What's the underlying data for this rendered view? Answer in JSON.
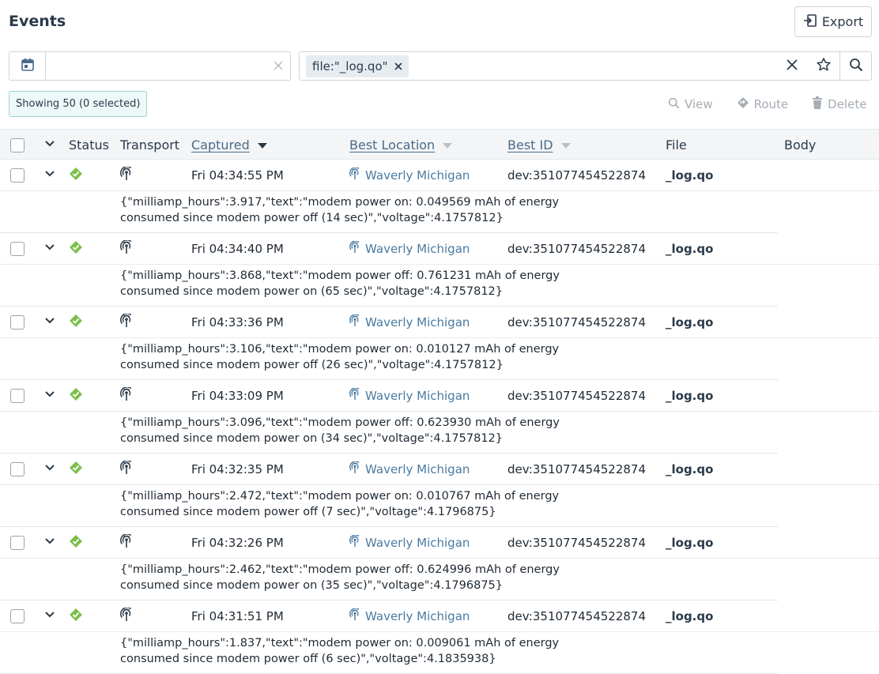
{
  "page": {
    "title": "Events"
  },
  "toolbar": {
    "export_label": "Export"
  },
  "filters": {
    "date_value": "",
    "date_placeholder": "",
    "search_chip": "file:\"_log.qo\""
  },
  "status": {
    "showing": "Showing 50 (0 selected)"
  },
  "row_actions": {
    "view": "View",
    "route": "Route",
    "delete": "Delete"
  },
  "columns": {
    "status": "Status",
    "transport": "Transport",
    "captured": "Captured",
    "best_location": "Best Location",
    "best_id": "Best ID",
    "file": "File",
    "body": "Body"
  },
  "colors": {
    "accent": "#4a7aa0",
    "status_ok": "#7cbf4a",
    "chip_bg": "#e7ecf1",
    "header_bg": "#f3f5f7"
  },
  "events": [
    {
      "captured": "Fri 04:34:55 PM",
      "location": "Waverly Michigan",
      "best_id": "dev:351077454522874",
      "file": "_log.qo",
      "body_line1": "{\"milliamp_hours\":3.917,\"text\":\"modem power on: 0.049569 mAh of energy",
      "body_line2": "consumed since modem power off (14 sec)\",\"voltage\":4.1757812}"
    },
    {
      "captured": "Fri 04:34:40 PM",
      "location": "Waverly Michigan",
      "best_id": "dev:351077454522874",
      "file": "_log.qo",
      "body_line1": "{\"milliamp_hours\":3.868,\"text\":\"modem power off: 0.761231 mAh of energy",
      "body_line2": "consumed since modem power on (65 sec)\",\"voltage\":4.1757812}"
    },
    {
      "captured": "Fri 04:33:36 PM",
      "location": "Waverly Michigan",
      "best_id": "dev:351077454522874",
      "file": "_log.qo",
      "body_line1": "{\"milliamp_hours\":3.106,\"text\":\"modem power on: 0.010127 mAh of energy",
      "body_line2": "consumed since modem power off (26 sec)\",\"voltage\":4.1757812}"
    },
    {
      "captured": "Fri 04:33:09 PM",
      "location": "Waverly Michigan",
      "best_id": "dev:351077454522874",
      "file": "_log.qo",
      "body_line1": "{\"milliamp_hours\":3.096,\"text\":\"modem power off: 0.623930 mAh of energy",
      "body_line2": "consumed since modem power on (34 sec)\",\"voltage\":4.1757812}"
    },
    {
      "captured": "Fri 04:32:35 PM",
      "location": "Waverly Michigan",
      "best_id": "dev:351077454522874",
      "file": "_log.qo",
      "body_line1": "{\"milliamp_hours\":2.472,\"text\":\"modem power on: 0.010767 mAh of energy",
      "body_line2": "consumed since modem power off (7 sec)\",\"voltage\":4.1796875}"
    },
    {
      "captured": "Fri 04:32:26 PM",
      "location": "Waverly Michigan",
      "best_id": "dev:351077454522874",
      "file": "_log.qo",
      "body_line1": "{\"milliamp_hours\":2.462,\"text\":\"modem power off: 0.624996 mAh of energy",
      "body_line2": "consumed since modem power on (35 sec)\",\"voltage\":4.1796875}"
    },
    {
      "captured": "Fri 04:31:51 PM",
      "location": "Waverly Michigan",
      "best_id": "dev:351077454522874",
      "file": "_log.qo",
      "body_line1": "{\"milliamp_hours\":1.837,\"text\":\"modem power on: 0.009061 mAh of energy",
      "body_line2": "consumed since modem power off (6 sec)\",\"voltage\":4.1835938}"
    }
  ]
}
